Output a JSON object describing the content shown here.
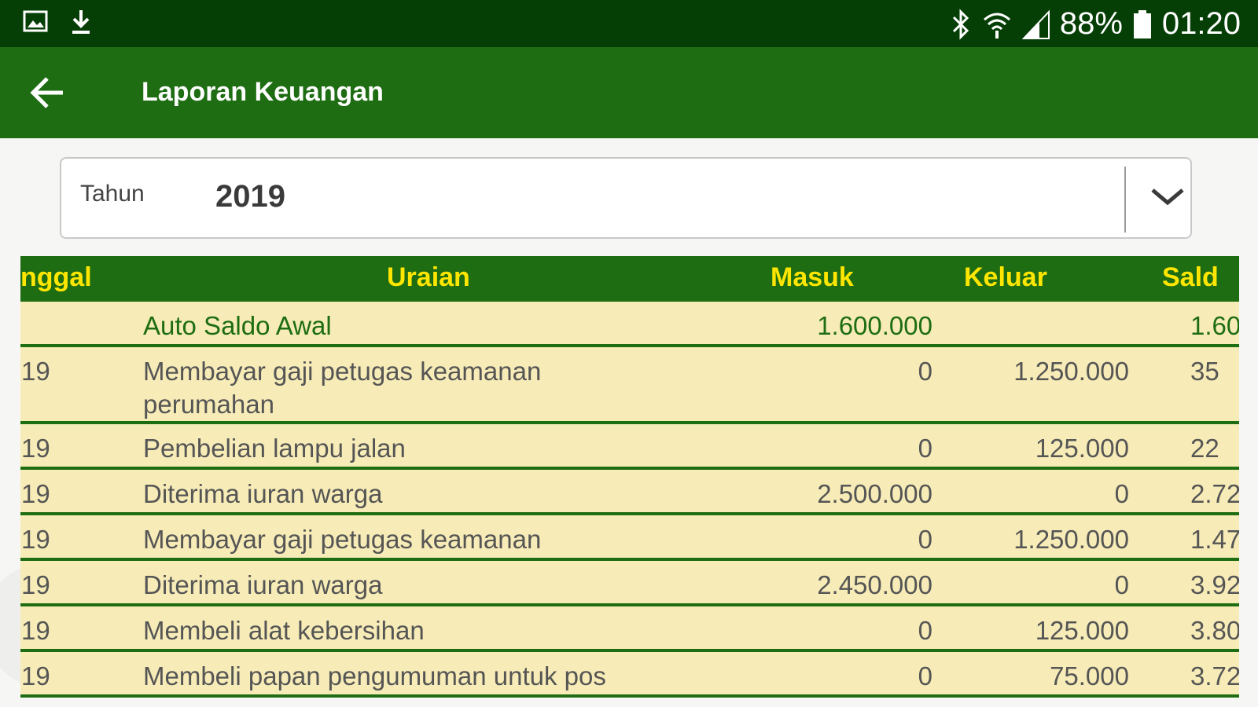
{
  "status_bar": {
    "battery": "88%",
    "time": "01:20"
  },
  "app_bar": {
    "title": "Laporan Keuangan"
  },
  "filter": {
    "label": "Tahun",
    "value": "2019"
  },
  "table": {
    "headers": {
      "date": "nggal",
      "description": "Uraian",
      "in": "Masuk",
      "out": "Keluar",
      "balance": "Sald"
    },
    "rows": [
      {
        "date": "",
        "description": "Auto Saldo Awal",
        "in": "1.600.000",
        "out": "",
        "balance": "1.60"
      },
      {
        "date": "-19",
        "description": "Membayar gaji petugas keamanan",
        "description2": "perumahan",
        "in": "0",
        "out": "1.250.000",
        "balance": "35"
      },
      {
        "date": "-19",
        "description": "Pembelian lampu jalan",
        "in": "0",
        "out": "125.000",
        "balance": "22"
      },
      {
        "date": "-19",
        "description": "Diterima iuran warga",
        "in": "2.500.000",
        "out": "0",
        "balance": "2.72"
      },
      {
        "date": "-19",
        "description": "Membayar gaji petugas keamanan",
        "in": "0",
        "out": "1.250.000",
        "balance": "1.47"
      },
      {
        "date": "-19",
        "description": "Diterima iuran warga",
        "in": "2.450.000",
        "out": "0",
        "balance": "3.92"
      },
      {
        "date": "-19",
        "description": "Membeli alat kebersihan",
        "in": "0",
        "out": "125.000",
        "balance": "3.80"
      },
      {
        "date": "-19",
        "description": "Membeli papan pengumuman untuk pos",
        "in": "0",
        "out": "75.000",
        "balance": "3.72"
      }
    ]
  },
  "colors": {
    "status_bar": "#063f06",
    "app_bar": "#1e6d12",
    "header_text": "#ffe600",
    "row_bg": "#f7ecb7"
  }
}
